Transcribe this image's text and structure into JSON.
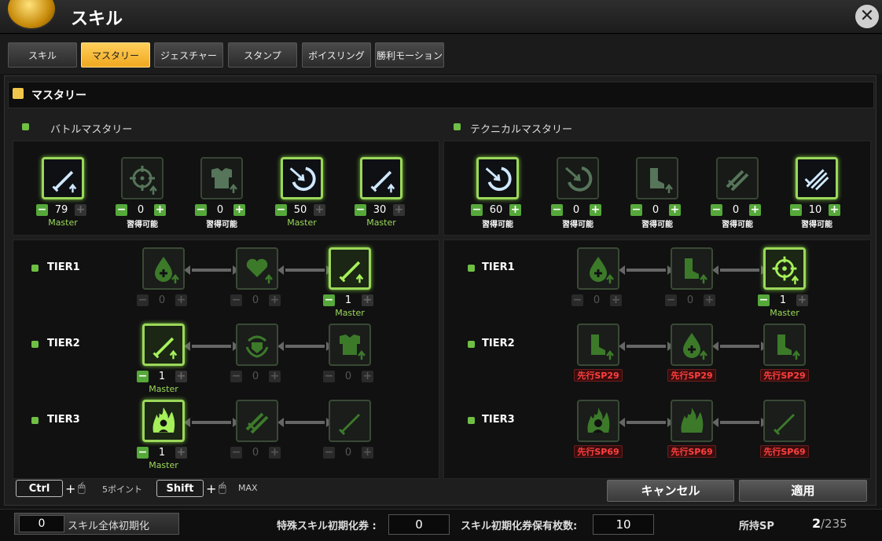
{
  "window": {
    "title": "スキル"
  },
  "tabs": [
    {
      "label": "スキル",
      "active": false
    },
    {
      "label": "マスタリー",
      "active": true
    },
    {
      "label": "ジェスチャー",
      "active": false
    },
    {
      "label": "スタンプ",
      "active": false
    },
    {
      "label": "ボイスリング",
      "active": false
    },
    {
      "label": "勝利モーション",
      "active": false
    }
  ],
  "section": {
    "title": "マスタリー"
  },
  "battle": {
    "title": "バトルマスタリー",
    "skills": [
      {
        "icon": "sword-up-icon",
        "value": "79",
        "status": "Master"
      },
      {
        "icon": "crosshair-up-icon",
        "value": "0",
        "status": "習得可能"
      },
      {
        "icon": "armor-up-icon",
        "value": "0",
        "status": "習得可能"
      },
      {
        "icon": "shield-arrow-icon",
        "value": "50",
        "status": "Master"
      },
      {
        "icon": "sword-up-icon",
        "value": "30",
        "status": "Master"
      }
    ],
    "tiers": [
      {
        "label": "TIER1",
        "nodes": [
          {
            "icon": "drop-plus-icon",
            "value": "0",
            "status": ""
          },
          {
            "icon": "heart-up-icon",
            "value": "0",
            "status": ""
          },
          {
            "icon": "sword-up-icon",
            "value": "1",
            "status": "Master"
          }
        ]
      },
      {
        "label": "TIER2",
        "nodes": [
          {
            "icon": "sword-up-icon",
            "value": "1",
            "status": "Master"
          },
          {
            "icon": "wreath-shield-icon",
            "value": "0",
            "status": ""
          },
          {
            "icon": "armor-up-icon",
            "value": "0",
            "status": ""
          }
        ]
      },
      {
        "label": "TIER3",
        "nodes": [
          {
            "icon": "flame-figure-icon",
            "value": "1",
            "status": "Master"
          },
          {
            "icon": "crossed-swords-icon",
            "value": "0",
            "status": ""
          },
          {
            "icon": "sword-icon",
            "value": "0",
            "status": ""
          }
        ]
      }
    ]
  },
  "technical": {
    "title": "テクニカルマスタリー",
    "skills": [
      {
        "icon": "shield-arrow-icon",
        "value": "60",
        "status": "習得可能"
      },
      {
        "icon": "shield-arrow-icon",
        "value": "0",
        "status": "習得可能"
      },
      {
        "icon": "boot-up-icon",
        "value": "0",
        "status": "習得可能"
      },
      {
        "icon": "swords-icon",
        "value": "0",
        "status": "習得可能"
      },
      {
        "icon": "claw-slash-icon",
        "value": "10",
        "status": "習得可能"
      }
    ],
    "tiers": [
      {
        "label": "TIER1",
        "nodes": [
          {
            "icon": "drop-plus-icon",
            "value": "0",
            "status": ""
          },
          {
            "icon": "boot-up-icon",
            "value": "0",
            "status": ""
          },
          {
            "icon": "crosshair-up-icon",
            "value": "1",
            "status": "Master"
          }
        ]
      },
      {
        "label": "TIER2",
        "nodes": [
          {
            "icon": "boot-up-icon",
            "status": "先行SP29"
          },
          {
            "icon": "drop-plus-icon",
            "status": "先行SP29"
          },
          {
            "icon": "boot-up-icon",
            "status": "先行SP29"
          }
        ]
      },
      {
        "label": "TIER3",
        "nodes": [
          {
            "icon": "flame-figure-icon",
            "status": "先行SP69"
          },
          {
            "icon": "flame-icon",
            "status": "先行SP69"
          },
          {
            "icon": "sword-icon",
            "status": "先行SP69"
          }
        ]
      }
    ]
  },
  "hints": {
    "ctrl_key": "Ctrl",
    "ctrl_text": "5ポイント",
    "shift_key": "Shift",
    "shift_text": "MAX"
  },
  "buttons": {
    "cancel": "キャンセル",
    "apply": "適用"
  },
  "footer": {
    "reset_count": "0",
    "reset_label": "スキル全体初期化",
    "special_label": "特殊スキル初期化券 :",
    "special_value": "0",
    "owned_label": "スキル初期化券保有枚数:",
    "owned_value": "10",
    "sp_label": "所持SP",
    "sp_current": "2",
    "sp_total": "/235"
  },
  "colors": {
    "accent": "#f0a820",
    "active_green": "#9bd85a",
    "locked_red": "#ff4040"
  }
}
